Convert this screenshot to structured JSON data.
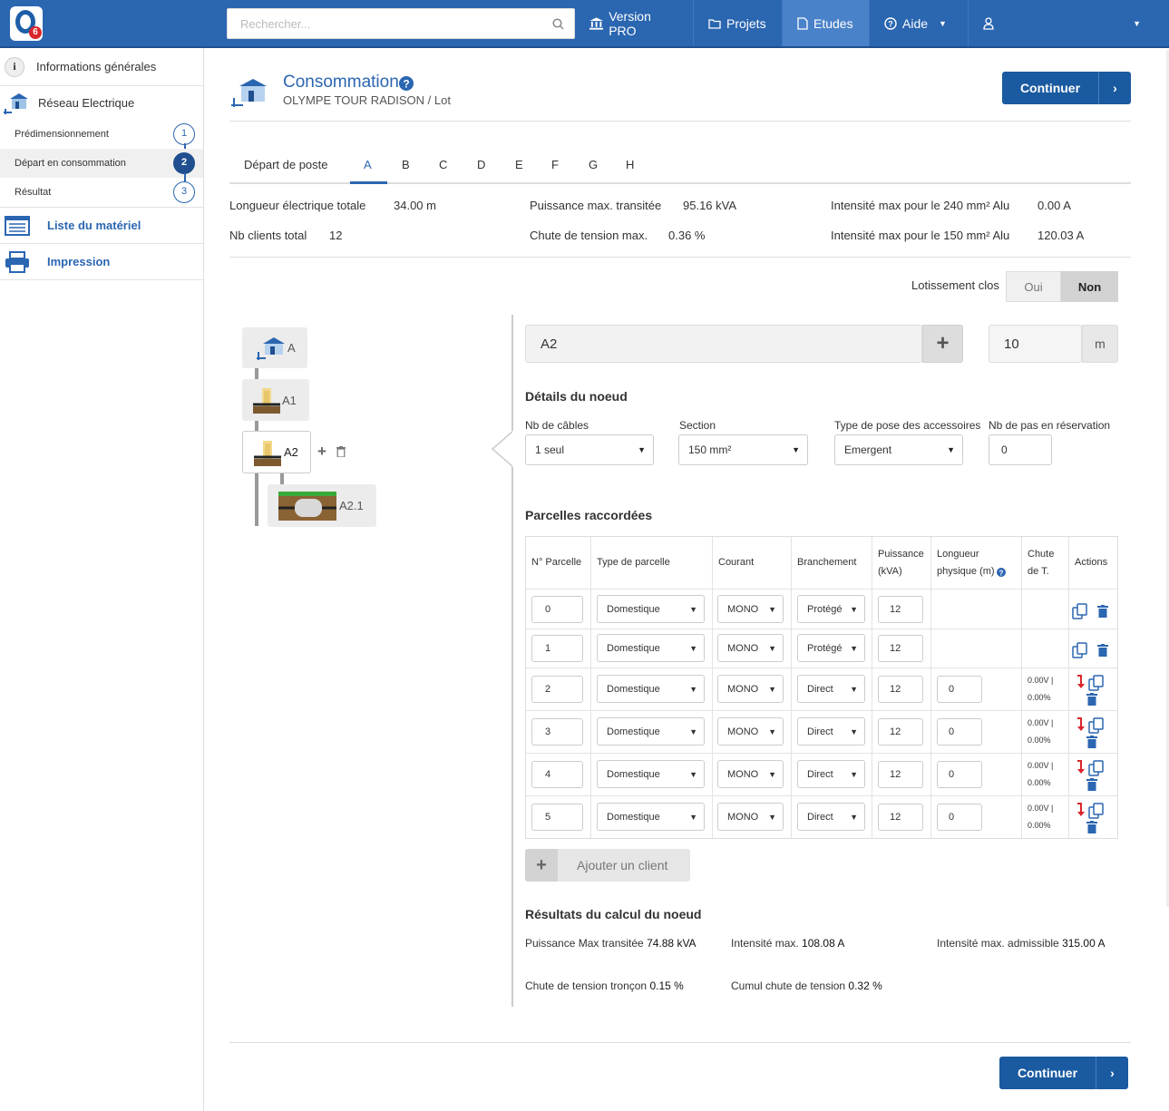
{
  "app": {
    "search_placeholder": "Rechercher..."
  },
  "nav": {
    "version_pro": "Version PRO",
    "projets": "Projets",
    "etudes": "Etudes",
    "aide": "Aide"
  },
  "sidebar": {
    "info_generales": "Informations générales",
    "reseau": "Réseau Electrique",
    "steps": [
      {
        "label": "Prédimensionnement",
        "num": "1"
      },
      {
        "label": "Départ en consommation",
        "num": "2"
      },
      {
        "label": "Résultat",
        "num": "3"
      }
    ],
    "materiel": "Liste du matériel",
    "impression": "Impression"
  },
  "header": {
    "title": "Consommation",
    "subtitle": "OLYMPE TOUR RADISON / Lot",
    "continue": "Continuer"
  },
  "tabs": [
    "Départ de poste",
    "A",
    "B",
    "C",
    "D",
    "E",
    "F",
    "G",
    "H"
  ],
  "summary": {
    "longueur_label": "Longueur électrique totale",
    "longueur_value": "34.00 m",
    "puissance_label": "Puissance max. transitée",
    "puissance_value": "95.16 kVA",
    "i240_label": "Intensité max pour le 240 mm² Alu",
    "i240_value": "0.00 A",
    "clients_label": "Nb clients total",
    "clients_value": "12",
    "chute_label": "Chute de tension max.",
    "chute_value": "0.36 %",
    "i150_label": "Intensité max pour le 150 mm² Alu",
    "i150_value": "120.03 A"
  },
  "lotissement": {
    "label": "Lotissement clos",
    "oui": "Oui",
    "non": "Non"
  },
  "tree": {
    "nodes": [
      "A",
      "A1",
      "A2",
      "A2.1"
    ]
  },
  "node": {
    "name": "A2",
    "length": "10",
    "unit": "m",
    "details_title": "Détails du noeud",
    "cables_label": "Nb de câbles",
    "cables_value": "1 seul",
    "section_label": "Section",
    "section_value": "150 mm²",
    "pose_label": "Type de pose des accessoires",
    "pose_value": "Emergent",
    "pas_label": "Nb de pas en réservation",
    "pas_value": "0"
  },
  "parcelles": {
    "title": "Parcelles raccordées",
    "headers": {
      "num": "N° Parcelle",
      "type": "Type de parcelle",
      "courant": "Courant",
      "branchement": "Branchement",
      "puissance1": "Puissance",
      "puissance2": "(kVA)",
      "longueur1": "Longueur",
      "longueur2": "physique (m)",
      "chute1": "Chute",
      "chute2": "de T.",
      "actions": "Actions"
    },
    "rows": [
      {
        "num": "0",
        "type": "Domestique",
        "courant": "MONO",
        "branchement": "Protégé",
        "puissance": "12",
        "longueur": "",
        "chute1": "",
        "chute2": ""
      },
      {
        "num": "1",
        "type": "Domestique",
        "courant": "MONO",
        "branchement": "Protégé",
        "puissance": "12",
        "longueur": "",
        "chute1": "",
        "chute2": ""
      },
      {
        "num": "2",
        "type": "Domestique",
        "courant": "MONO",
        "branchement": "Direct",
        "puissance": "12",
        "longueur": "0",
        "chute1": "0.00V |",
        "chute2": "0.00%"
      },
      {
        "num": "3",
        "type": "Domestique",
        "courant": "MONO",
        "branchement": "Direct",
        "puissance": "12",
        "longueur": "0",
        "chute1": "0.00V |",
        "chute2": "0.00%"
      },
      {
        "num": "4",
        "type": "Domestique",
        "courant": "MONO",
        "branchement": "Direct",
        "puissance": "12",
        "longueur": "0",
        "chute1": "0.00V |",
        "chute2": "0.00%"
      },
      {
        "num": "5",
        "type": "Domestique",
        "courant": "MONO",
        "branchement": "Direct",
        "puissance": "12",
        "longueur": "0",
        "chute1": "0.00V |",
        "chute2": "0.00%"
      }
    ],
    "add_client": "Ajouter un client"
  },
  "resultats": {
    "title": "Résultats du calcul du noeud",
    "puissance_label": "Puissance Max transitée",
    "puissance_value": "74.88 kVA",
    "intensite_label": "Intensité max.",
    "intensite_value": "108.08 A",
    "admissible_label": "Intensité max. admissible",
    "admissible_value": "315.00 A",
    "chute_label": "Chute de tension tronçon",
    "chute_value": "0.15 %",
    "cumul_label": "Cumul chute de tension",
    "cumul_value": "0.32 %"
  },
  "footer": {
    "continue": "Continuer"
  },
  "colors": {
    "primary": "#2b66b1",
    "dark": "#1a5aa0",
    "danger": "#d9262c"
  }
}
